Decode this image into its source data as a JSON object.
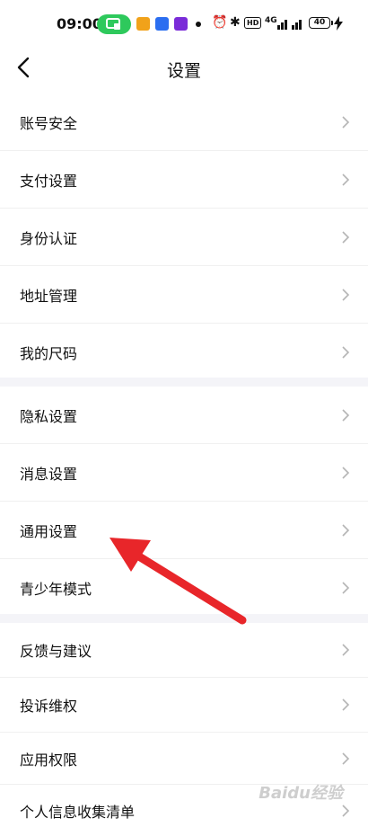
{
  "status_bar": {
    "time": "09:00",
    "hd_label": "HD",
    "battery_level": "40",
    "signal_label": "4G"
  },
  "header": {
    "title": "设置"
  },
  "groups": [
    {
      "items": [
        {
          "label": "账号安全"
        },
        {
          "label": "支付设置"
        },
        {
          "label": "身份认证"
        },
        {
          "label": "地址管理"
        },
        {
          "label": "我的尺码"
        }
      ]
    },
    {
      "items": [
        {
          "label": "隐私设置"
        },
        {
          "label": "消息设置"
        },
        {
          "label": "通用设置"
        },
        {
          "label": "青少年模式"
        }
      ]
    },
    {
      "items": [
        {
          "label": "反馈与建议"
        },
        {
          "label": "投诉维权"
        },
        {
          "label": "应用权限"
        },
        {
          "label": "个人信息收集清单"
        }
      ]
    }
  ],
  "annotation": {
    "arrow_color": "#e8262a",
    "points_to": "通用设置"
  },
  "watermark": {
    "text": "Baidu经验"
  },
  "colors": {
    "pill_green": "#2ec95c",
    "divider": "#f4f4f8",
    "chevron": "#b5b5b5"
  }
}
